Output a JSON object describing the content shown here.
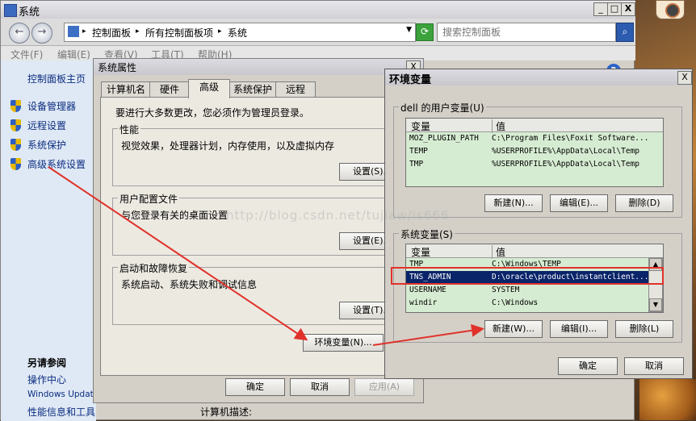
{
  "window": {
    "title": "系统",
    "controls": [
      "_",
      "□",
      "X"
    ]
  },
  "nav": {
    "back": "←",
    "forward": "→",
    "breadcrumbs": [
      "控制面板",
      "所有控制面板项",
      "系统"
    ],
    "search_placeholder": "搜索控制面板"
  },
  "menubar": [
    "文件(F)",
    "编辑(E)",
    "查看(V)",
    "工具(T)",
    "帮助(H)"
  ],
  "left_pane": {
    "home": "控制面板主页",
    "links": [
      "设备管理器",
      "远程设置",
      "系统保护",
      "高级系统设置"
    ],
    "see_also_title": "另请参阅",
    "see_also": [
      "操作中心",
      "Windows Update",
      "性能信息和工具"
    ]
  },
  "sysprop": {
    "title": "系统属性",
    "close": "X",
    "tabs": [
      "计算机名",
      "硬件",
      "高级",
      "系统保护",
      "远程"
    ],
    "active_tab": "高级",
    "admin_note": "要进行大多数更改，您必须作为管理员登录。",
    "groups": [
      {
        "title": "性能",
        "desc": "视觉效果，处理器计划，内存使用，以及虚拟内存",
        "button": "设置(S)..."
      },
      {
        "title": "用户配置文件",
        "desc": "与您登录有关的桌面设置",
        "button": "设置(E)..."
      },
      {
        "title": "启动和故障恢复",
        "desc": "系统启动、系统失败和调试信息",
        "button": "设置(T)..."
      }
    ],
    "env_button": "环境变量(N)...",
    "ok": "确定",
    "cancel": "取消",
    "apply": "应用(A)"
  },
  "envvar": {
    "title": "环境变量",
    "close": "X",
    "user_group_title": "dell 的用户变量(U)",
    "col_var": "变量",
    "col_val": "值",
    "user_vars": [
      {
        "name": "MOZ_PLUGIN_PATH",
        "value": "C:\\Program Files\\Foxit Software..."
      },
      {
        "name": "TEMP",
        "value": "%USERPROFILE%\\AppData\\Local\\Temp"
      },
      {
        "name": "TMP",
        "value": "%USERPROFILE%\\AppData\\Local\\Temp"
      }
    ],
    "user_buttons": [
      "新建(N)...",
      "编辑(E)...",
      "删除(D)"
    ],
    "system_group_title": "系统变量(S)",
    "system_vars": [
      {
        "name": "TMP",
        "value": "C:\\Windows\\TEMP"
      },
      {
        "name": "TNS_ADMIN",
        "value": "D:\\oracle\\product\\instantclient..."
      },
      {
        "name": "USERNAME",
        "value": "SYSTEM"
      },
      {
        "name": "windir",
        "value": "C:\\Windows"
      }
    ],
    "selected_system_var": "TNS_ADMIN",
    "system_buttons": [
      "新建(W)...",
      "编辑(I)...",
      "删除(L)"
    ],
    "ok": "确定",
    "cancel": "取消"
  },
  "watermark": "http://blog.csdn.net/tujiaw/is666",
  "bottom_label": "计算机描述:",
  "colors": {
    "annotation_red": "#e0322a",
    "selection_blue": "#0a246a",
    "list_green": "#d6ecd2",
    "link_blue": "#0b2c80"
  }
}
